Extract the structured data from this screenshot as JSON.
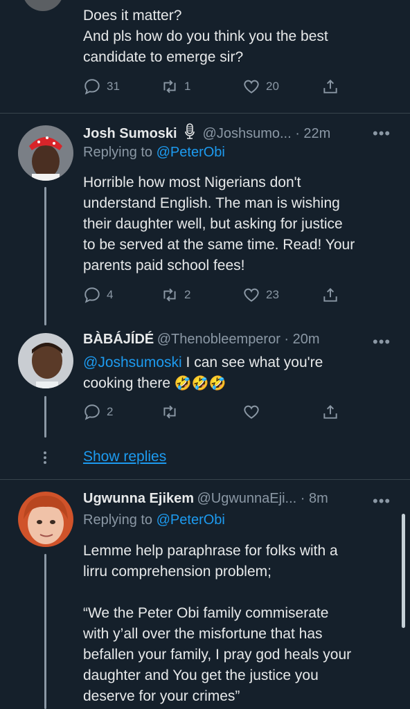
{
  "tweet0": {
    "text_line1": "Does it matter?",
    "text_line2": "And pls how do you think you the best",
    "text_line3": "candidate to emerge sir?",
    "replies": "31",
    "retweets": "1",
    "likes": "20"
  },
  "tweet1": {
    "name": "Josh Sumoski",
    "handle_time": "@Joshsumo... · 22m",
    "replying_prefix": "Replying to ",
    "replying_to": "@PeterObi",
    "lines": [
      "Horrible how most Nigerians don't",
      "understand English. The man is wishing",
      "their daughter well, but asking for justice",
      "to be served at the same time. Read! Your",
      "parents paid school fees!"
    ],
    "replies": "4",
    "retweets": "2",
    "likes": "23"
  },
  "tweet2": {
    "name": "BÀBÁJÍDÉ",
    "handle_time": "@Thenobleemperor · 20m",
    "mention": "@Joshsumoski",
    "line1_rest": " I can see what you're",
    "line2": "cooking there ",
    "emoji": "🤣🤣🤣",
    "replies": "2"
  },
  "show_replies": "Show replies",
  "tweet3": {
    "name": "Ugwunna Ejikem",
    "handle_time": "@UgwunnaEji... · 8m",
    "replying_prefix": "Replying to ",
    "replying_to": "@PeterObi",
    "lines": [
      "Lemme help paraphrase for folks with a",
      "lirru comprehension problem;",
      "",
      "“We the Peter Obi family commiserate",
      "with y’all over the misfortune that has",
      "befallen your family, I pray god heals your",
      "daughter and You get the justice you",
      "deserve for your crimes”"
    ]
  },
  "more_label": "•••",
  "colors": {
    "bg": "#15202b",
    "text": "#e7e9ea",
    "muted": "#8b98a5",
    "link": "#1d9bf0"
  }
}
